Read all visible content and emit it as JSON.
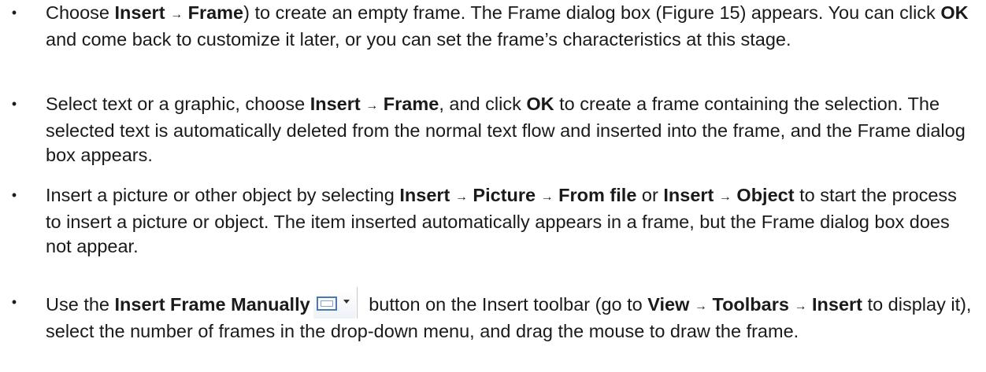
{
  "bullet_glyph": "•",
  "arrow": "→",
  "items": [
    {
      "t1": "Choose ",
      "b1": "Insert",
      "t2": " ",
      "a1": "→",
      "t3": " ",
      "b2": "Frame",
      "t4": ") to create an empty frame. The Frame dialog box (Figure 15) appears. You can click ",
      "b3": "OK",
      "t5": " and come back to customize it later, or you can set the frame’s characteristics at this stage."
    },
    {
      "t1": "Select text or a graphic, choose ",
      "b1": "Insert",
      "t2": " ",
      "a1": "→",
      "t3": " ",
      "b2": "Frame",
      "t4": ", and click ",
      "b3": "OK",
      "t5": " to create a frame containing the selection. The selected text is automatically deleted from the normal text flow and inserted into the frame, and the Frame dialog box appears."
    },
    {
      "t1": "Insert a picture or other object by selecting ",
      "b1": "Insert",
      "a1": "→",
      "b2": "Picture",
      "a2": "→",
      "b3": "From file",
      "t2": " or ",
      "b4": "Insert",
      "a3": "→",
      "b5": "Object",
      "t3": " to start the process to insert a picture or object. The item inserted automatically appears in a frame, but the Frame dialog box does not appear."
    },
    {
      "t1": "Use the ",
      "b1": "Insert Frame Manually",
      "t2": " button on the Insert toolbar (go to ",
      "b2": "View",
      "a1": "→",
      "b3": "Toolbars",
      "a2": "→",
      "b4": "Insert",
      "t3": " to display it), select the number of frames in the drop-down menu, and drag the mouse to draw the frame.",
      "icon": "insert-frame-icon"
    }
  ]
}
